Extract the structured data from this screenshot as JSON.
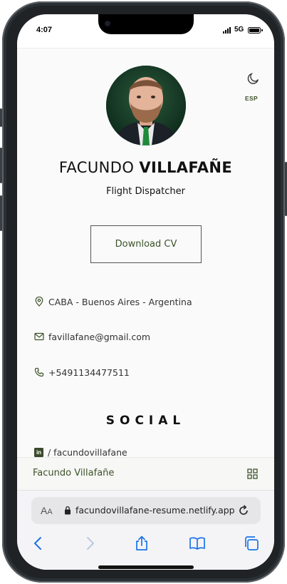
{
  "status_bar": {
    "time": "4:07",
    "network": "5G"
  },
  "profile": {
    "name_first": "FACUNDO",
    "name_last": "VILLAFAÑE",
    "role": "Flight Dispatcher",
    "language_toggle": "ESP",
    "theme_icon": "moon-icon",
    "download_label": "Download CV"
  },
  "contact": {
    "location": "CABA - Buenos Aires - Argentina",
    "email": "favillafane@gmail.com",
    "phone": "+5491134477511"
  },
  "social": {
    "title": "SOCIAL",
    "linkedin_icon_label": "in",
    "linkedin": "/ facundovillafane"
  },
  "app_bar": {
    "title": "Facundo Villafañe",
    "menu_icon": "grid-icon"
  },
  "browser": {
    "text_size_big": "A",
    "text_size_small": "A",
    "url": "facundovillafane-resume.netlify.app"
  },
  "colors": {
    "accent": "#3c5229",
    "frame": "#1f2326",
    "ios_blue": "#1a73e8"
  }
}
